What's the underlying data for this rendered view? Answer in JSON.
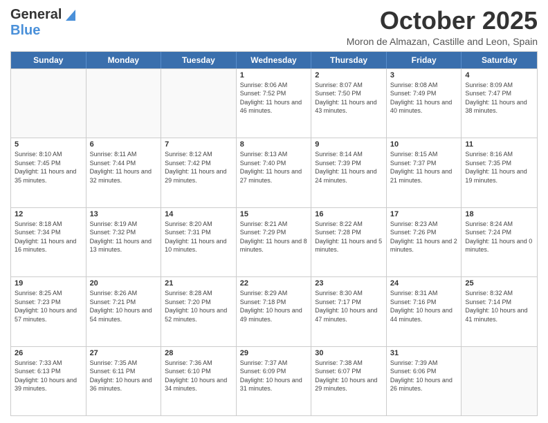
{
  "header": {
    "logo": {
      "line1": "General",
      "line2": "Blue"
    },
    "title": "October 2025",
    "subtitle": "Moron de Almazan, Castille and Leon, Spain"
  },
  "days_of_week": [
    "Sunday",
    "Monday",
    "Tuesday",
    "Wednesday",
    "Thursday",
    "Friday",
    "Saturday"
  ],
  "weeks": [
    [
      {
        "day": "",
        "info": ""
      },
      {
        "day": "",
        "info": ""
      },
      {
        "day": "",
        "info": ""
      },
      {
        "day": "1",
        "info": "Sunrise: 8:06 AM\nSunset: 7:52 PM\nDaylight: 11 hours and 46 minutes."
      },
      {
        "day": "2",
        "info": "Sunrise: 8:07 AM\nSunset: 7:50 PM\nDaylight: 11 hours and 43 minutes."
      },
      {
        "day": "3",
        "info": "Sunrise: 8:08 AM\nSunset: 7:49 PM\nDaylight: 11 hours and 40 minutes."
      },
      {
        "day": "4",
        "info": "Sunrise: 8:09 AM\nSunset: 7:47 PM\nDaylight: 11 hours and 38 minutes."
      }
    ],
    [
      {
        "day": "5",
        "info": "Sunrise: 8:10 AM\nSunset: 7:45 PM\nDaylight: 11 hours and 35 minutes."
      },
      {
        "day": "6",
        "info": "Sunrise: 8:11 AM\nSunset: 7:44 PM\nDaylight: 11 hours and 32 minutes."
      },
      {
        "day": "7",
        "info": "Sunrise: 8:12 AM\nSunset: 7:42 PM\nDaylight: 11 hours and 29 minutes."
      },
      {
        "day": "8",
        "info": "Sunrise: 8:13 AM\nSunset: 7:40 PM\nDaylight: 11 hours and 27 minutes."
      },
      {
        "day": "9",
        "info": "Sunrise: 8:14 AM\nSunset: 7:39 PM\nDaylight: 11 hours and 24 minutes."
      },
      {
        "day": "10",
        "info": "Sunrise: 8:15 AM\nSunset: 7:37 PM\nDaylight: 11 hours and 21 minutes."
      },
      {
        "day": "11",
        "info": "Sunrise: 8:16 AM\nSunset: 7:35 PM\nDaylight: 11 hours and 19 minutes."
      }
    ],
    [
      {
        "day": "12",
        "info": "Sunrise: 8:18 AM\nSunset: 7:34 PM\nDaylight: 11 hours and 16 minutes."
      },
      {
        "day": "13",
        "info": "Sunrise: 8:19 AM\nSunset: 7:32 PM\nDaylight: 11 hours and 13 minutes."
      },
      {
        "day": "14",
        "info": "Sunrise: 8:20 AM\nSunset: 7:31 PM\nDaylight: 11 hours and 10 minutes."
      },
      {
        "day": "15",
        "info": "Sunrise: 8:21 AM\nSunset: 7:29 PM\nDaylight: 11 hours and 8 minutes."
      },
      {
        "day": "16",
        "info": "Sunrise: 8:22 AM\nSunset: 7:28 PM\nDaylight: 11 hours and 5 minutes."
      },
      {
        "day": "17",
        "info": "Sunrise: 8:23 AM\nSunset: 7:26 PM\nDaylight: 11 hours and 2 minutes."
      },
      {
        "day": "18",
        "info": "Sunrise: 8:24 AM\nSunset: 7:24 PM\nDaylight: 11 hours and 0 minutes."
      }
    ],
    [
      {
        "day": "19",
        "info": "Sunrise: 8:25 AM\nSunset: 7:23 PM\nDaylight: 10 hours and 57 minutes."
      },
      {
        "day": "20",
        "info": "Sunrise: 8:26 AM\nSunset: 7:21 PM\nDaylight: 10 hours and 54 minutes."
      },
      {
        "day": "21",
        "info": "Sunrise: 8:28 AM\nSunset: 7:20 PM\nDaylight: 10 hours and 52 minutes."
      },
      {
        "day": "22",
        "info": "Sunrise: 8:29 AM\nSunset: 7:18 PM\nDaylight: 10 hours and 49 minutes."
      },
      {
        "day": "23",
        "info": "Sunrise: 8:30 AM\nSunset: 7:17 PM\nDaylight: 10 hours and 47 minutes."
      },
      {
        "day": "24",
        "info": "Sunrise: 8:31 AM\nSunset: 7:16 PM\nDaylight: 10 hours and 44 minutes."
      },
      {
        "day": "25",
        "info": "Sunrise: 8:32 AM\nSunset: 7:14 PM\nDaylight: 10 hours and 41 minutes."
      }
    ],
    [
      {
        "day": "26",
        "info": "Sunrise: 7:33 AM\nSunset: 6:13 PM\nDaylight: 10 hours and 39 minutes."
      },
      {
        "day": "27",
        "info": "Sunrise: 7:35 AM\nSunset: 6:11 PM\nDaylight: 10 hours and 36 minutes."
      },
      {
        "day": "28",
        "info": "Sunrise: 7:36 AM\nSunset: 6:10 PM\nDaylight: 10 hours and 34 minutes."
      },
      {
        "day": "29",
        "info": "Sunrise: 7:37 AM\nSunset: 6:09 PM\nDaylight: 10 hours and 31 minutes."
      },
      {
        "day": "30",
        "info": "Sunrise: 7:38 AM\nSunset: 6:07 PM\nDaylight: 10 hours and 29 minutes."
      },
      {
        "day": "31",
        "info": "Sunrise: 7:39 AM\nSunset: 6:06 PM\nDaylight: 10 hours and 26 minutes."
      },
      {
        "day": "",
        "info": ""
      }
    ]
  ]
}
